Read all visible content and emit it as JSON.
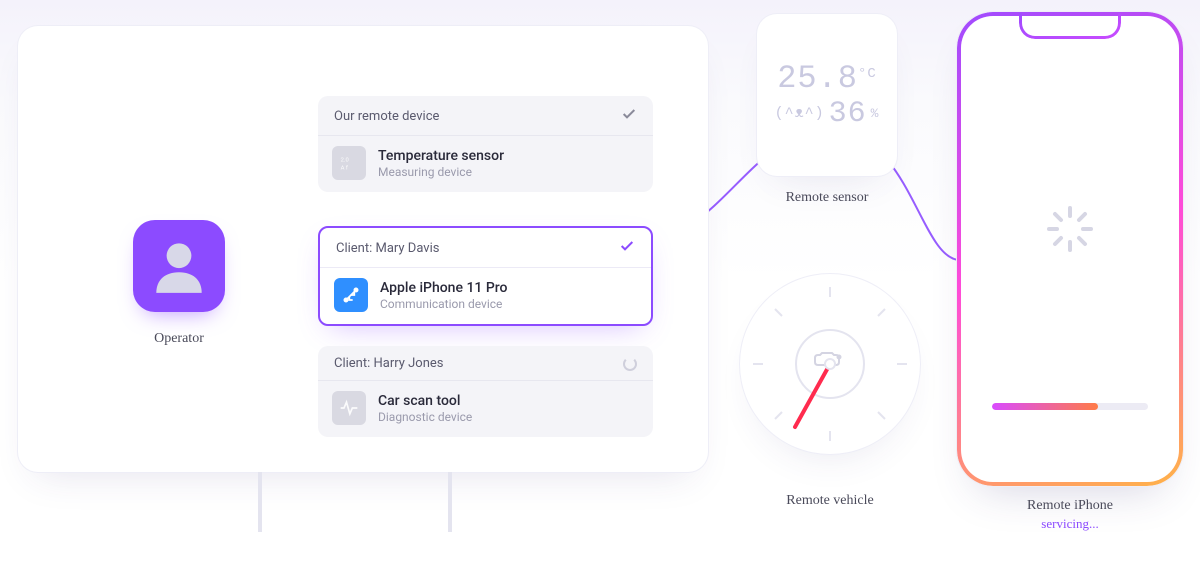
{
  "operator": {
    "label": "Operator"
  },
  "cards": [
    {
      "header": "Our remote device",
      "title": "Temperature sensor",
      "subtitle": "Measuring device",
      "status": "done"
    },
    {
      "header": "Client: Mary Davis",
      "title": "Apple iPhone 11 Pro",
      "subtitle": "Communication device",
      "status": "active"
    },
    {
      "header": "Client: Harry Jones",
      "title": "Car scan tool",
      "subtitle": "Diagnostic device",
      "status": "loading"
    }
  ],
  "sensor": {
    "label": "Remote sensor",
    "temperature": "25.8",
    "temperature_unit": "°C",
    "humidity": "36",
    "humidity_unit": "%"
  },
  "vehicle": {
    "label": "Remote vehicle"
  },
  "phone": {
    "label": "Remote iPhone",
    "status": "servicing...",
    "progress_pct": 68
  }
}
